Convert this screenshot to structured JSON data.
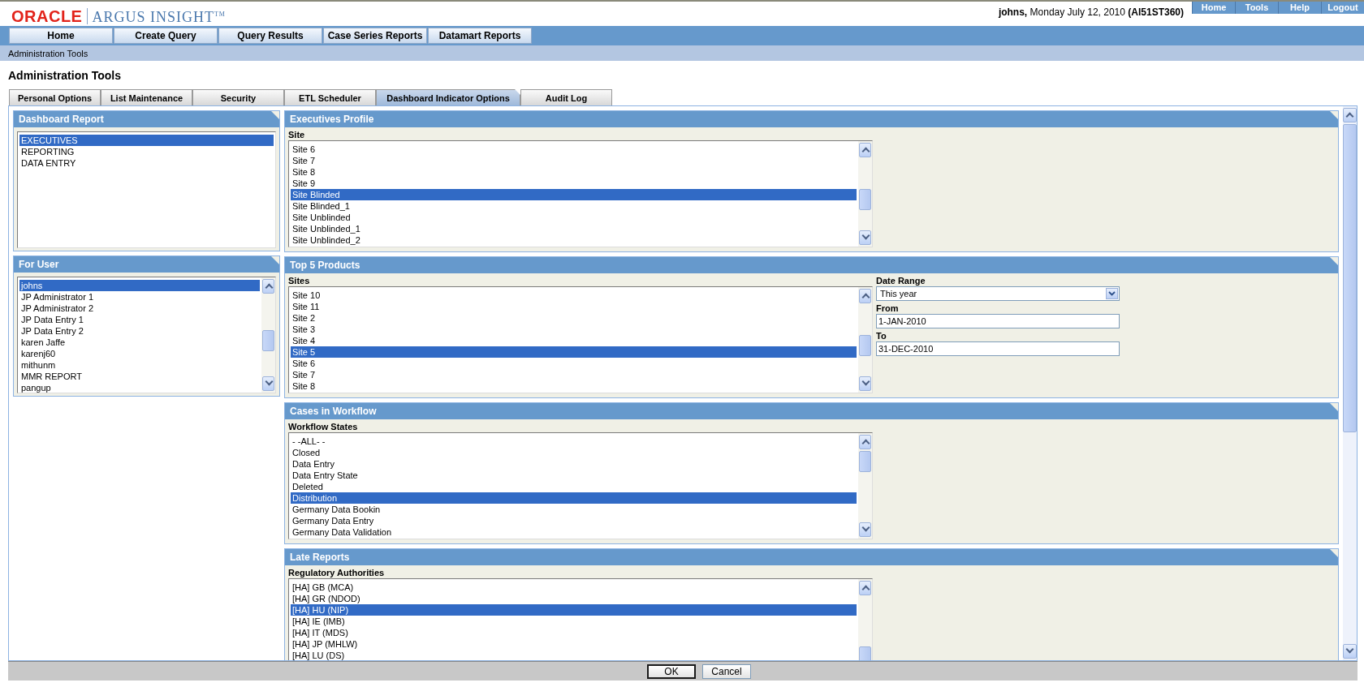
{
  "header": {
    "logo": "ORACLE",
    "product": "ARGUS INSIGHT$^{TM}$",
    "user_line": "**johns,** Monday July 12, 2010 **(AI51ST360)**"
  },
  "top_links": [
    "Home",
    "Tools",
    "Help",
    "Logout"
  ],
  "nav": [
    "Home",
    "Create Query",
    "Query Results",
    "Case Series Reports",
    "Datamart Reports"
  ],
  "breadcrumb": "Administration Tools",
  "page_title": "Administration Tools",
  "tabs": [
    {
      "label": "Personal Options",
      "selected": false
    },
    {
      "label": "List Maintenance",
      "selected": false
    },
    {
      "label": "Security",
      "selected": false
    },
    {
      "label": "ETL Scheduler",
      "selected": false
    },
    {
      "label": "Dashboard Indicator Options",
      "selected": true
    },
    {
      "label": "Audit Log",
      "selected": false
    }
  ],
  "left_panels": [
    {
      "title": "Dashboard Report",
      "scrollbar": false,
      "items": [
        {
          "label": "EXECUTIVES",
          "selected": true
        },
        {
          "label": "REPORTING",
          "selected": false
        },
        {
          "label": "DATA ENTRY",
          "selected": false
        }
      ]
    },
    {
      "title": "For User",
      "scrollbar": true,
      "items": [
        {
          "label": "johns",
          "selected": true
        },
        {
          "label": "JP Administrator 1",
          "selected": false
        },
        {
          "label": "JP Administrator 2",
          "selected": false
        },
        {
          "label": "JP Data Entry 1",
          "selected": false
        },
        {
          "label": "JP Data Entry 2",
          "selected": false
        },
        {
          "label": "karen Jaffe",
          "selected": false
        },
        {
          "label": "karenj60",
          "selected": false
        },
        {
          "label": "mithunm",
          "selected": false
        },
        {
          "label": "MMR REPORT",
          "selected": false
        },
        {
          "label": "pangup",
          "selected": false
        }
      ]
    }
  ],
  "panels": [
    {
      "title": "Executives Profile",
      "list_label": "Site",
      "items": [
        {
          "label": "Site 6",
          "selected": false
        },
        {
          "label": "Site 7",
          "selected": false
        },
        {
          "label": "Site 8",
          "selected": false
        },
        {
          "label": "Site 9",
          "selected": false
        },
        {
          "label": "Site Blinded",
          "selected": true
        },
        {
          "label": "Site Blinded_1",
          "selected": false
        },
        {
          "label": "Site Unblinded",
          "selected": false
        },
        {
          "label": "Site Unblinded_1",
          "selected": false
        },
        {
          "label": "Site Unblinded_2",
          "selected": false
        }
      ]
    },
    {
      "title": "Top 5 Products",
      "list_label": "Sites",
      "items": [
        {
          "label": "Site 10",
          "selected": false
        },
        {
          "label": "Site 11",
          "selected": false
        },
        {
          "label": "Site 2",
          "selected": false
        },
        {
          "label": "Site 3",
          "selected": false
        },
        {
          "label": "Site 4",
          "selected": false
        },
        {
          "label": "Site 5",
          "selected": true
        },
        {
          "label": "Site 6",
          "selected": false
        },
        {
          "label": "Site 7",
          "selected": false
        },
        {
          "label": "Site 8",
          "selected": false
        }
      ],
      "fields": [
        {
          "kind": "dropdown",
          "label": "Date Range",
          "value": "This year"
        },
        {
          "kind": "text",
          "label": "From",
          "value": "1-JAN-2010"
        },
        {
          "kind": "text",
          "label": "To",
          "value": "31-DEC-2010"
        }
      ]
    },
    {
      "title": "Cases in Workflow",
      "list_label": "Workflow States",
      "items": [
        {
          "label": "- -ALL- -",
          "selected": false
        },
        {
          "label": "Closed",
          "selected": false
        },
        {
          "label": "Data Entry",
          "selected": false
        },
        {
          "label": "Data Entry State",
          "selected": false
        },
        {
          "label": "Deleted",
          "selected": false
        },
        {
          "label": "Distribution",
          "selected": true
        },
        {
          "label": "Germany Data Bookin",
          "selected": false
        },
        {
          "label": "Germany Data Entry",
          "selected": false
        },
        {
          "label": "Germany Data Validation",
          "selected": false
        }
      ]
    },
    {
      "title": "Late Reports",
      "list_label": "Regulatory Authorities",
      "items": [
        {
          "label": "[HA] GB (MCA)",
          "selected": false
        },
        {
          "label": "[HA] GR (NDOD)",
          "selected": false
        },
        {
          "label": "[HA] HU (NIP)",
          "selected": true
        },
        {
          "label": "[HA] IE (IMB)",
          "selected": false
        },
        {
          "label": "[HA] IT (MDS)",
          "selected": false
        },
        {
          "label": "[HA] JP (MHLW)",
          "selected": false
        },
        {
          "label": "[HA] LU (DS)",
          "selected": false
        }
      ]
    }
  ],
  "buttons": [
    {
      "label": "OK",
      "default": true
    },
    {
      "label": "Cancel",
      "default": false
    }
  ]
}
